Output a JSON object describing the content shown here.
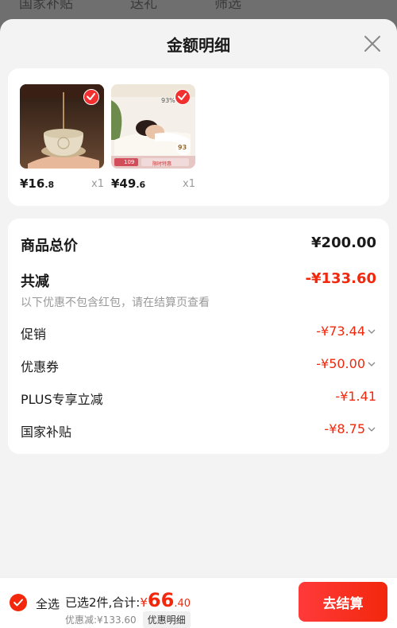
{
  "background_tabs": [
    "国家补贴",
    "送礼",
    "筛选"
  ],
  "sheet": {
    "title": "金额明细"
  },
  "products": [
    {
      "price_int": "¥16",
      "price_dec": ".8",
      "qty": "x1",
      "image": "incense-burner"
    },
    {
      "price_int": "¥49",
      "price_dec": ".6",
      "qty": "x1",
      "image": "latex-pillow",
      "overlay": {
        "tag": "93%",
        "badge": "93",
        "price_chip": "109",
        "banner": "限时特惠"
      }
    }
  ],
  "details": {
    "total_label": "商品总价",
    "total_value": "¥200.00",
    "reduce_label": "共减",
    "reduce_value": "-¥133.60",
    "note": "以下优惠不包含红包，请在结算页查看",
    "items": [
      {
        "label": "促销",
        "value": "-¥73.44",
        "expandable": true
      },
      {
        "label": "优惠券",
        "value": "-¥50.00",
        "expandable": true
      },
      {
        "label": "PLUS专享立减",
        "value": "-¥1.41",
        "expandable": false
      },
      {
        "label": "国家补贴",
        "value": "-¥8.75",
        "expandable": true
      }
    ]
  },
  "footer": {
    "select_all": "全选",
    "selected_text": "已选2件,合计:",
    "amount_symbol": "¥",
    "amount_int": "66",
    "amount_dec": ".40",
    "discount_text": "优惠减:¥133.60",
    "detail_chip": "优惠明细",
    "checkout": "去结算"
  },
  "colors": {
    "accent": "#f2270c",
    "text": "#1a1a1a",
    "muted": "#999999"
  }
}
